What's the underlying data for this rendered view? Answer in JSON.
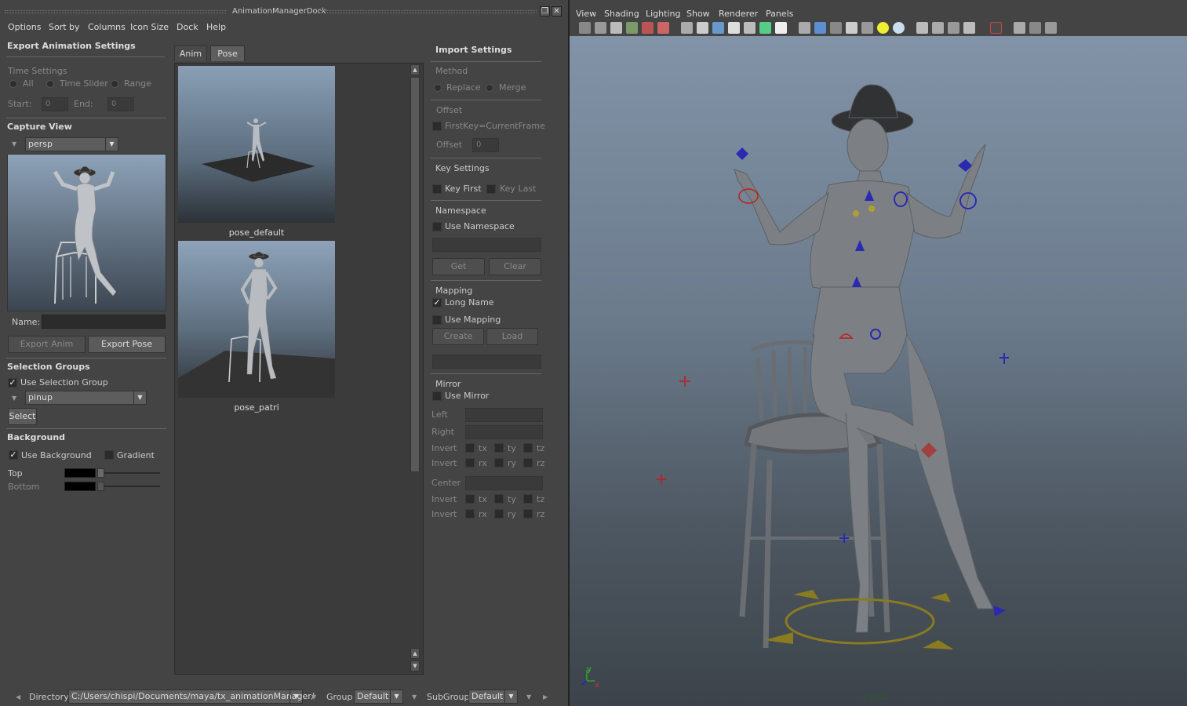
{
  "window": {
    "title": "AnimationManagerDock"
  },
  "menu": [
    "Options",
    "Sort by",
    "Columns",
    "Icon Size",
    "Dock",
    "Help"
  ],
  "export": {
    "header": "Export Animation Settings",
    "time_settings_label": "Time Settings",
    "radio_all": "All",
    "radio_time_slider": "Time Slider",
    "radio_range": "Range",
    "start_label": "Start:",
    "start_value": "0",
    "end_label": "End:",
    "end_value": "0"
  },
  "capture": {
    "header": "Capture View",
    "camera": "persp",
    "name_label": "Name:",
    "name_value": "",
    "export_anim_button": "Export Anim",
    "export_pose_button": "Export Pose"
  },
  "selection": {
    "header": "Selection Groups",
    "use_group_label": "Use Selection Group",
    "use_group_checked": true,
    "group": "pinup",
    "select_button": "Select"
  },
  "background": {
    "header": "Background",
    "use_bg_label": "Use Background",
    "use_bg_checked": true,
    "gradient_label": "Gradient",
    "gradient_checked": false,
    "top_label": "Top",
    "bottom_label": "Bottom",
    "top_color": "#000000",
    "bottom_color": "#000000"
  },
  "tabs": [
    {
      "label": "Anim",
      "active": false
    },
    {
      "label": "Pose",
      "active": true
    }
  ],
  "poses": [
    {
      "name": "pose_default"
    },
    {
      "name": "pose_patri"
    }
  ],
  "import": {
    "header": "Import Settings",
    "method_label": "Method",
    "replace_label": "Replace",
    "merge_label": "Merge",
    "offset_label": "Offset",
    "firstkey_label": "FirstKey=CurrentFrame",
    "offset_field_label": "Offset",
    "offset_value": "0",
    "key_settings_label": "Key Settings",
    "key_first_label": "Key First",
    "key_last_label": "Key Last",
    "namespace_label": "Namespace",
    "use_namespace_label": "Use Namespace",
    "get_button": "Get",
    "clear_button": "Clear",
    "mapping_label": "Mapping",
    "long_name_label": "Long Name",
    "long_name_checked": true,
    "use_mapping_label": "Use Mapping",
    "create_button": "Create",
    "load_button": "Load",
    "mirror_label": "Mirror",
    "use_mirror_label": "Use Mirror",
    "left_label": "Left",
    "right_label": "Right",
    "invert_label": "Invert",
    "center_label": "Center",
    "tx": "tx",
    "ty": "ty",
    "tz": "tz",
    "rx": "rx",
    "ry": "ry",
    "rz": "rz"
  },
  "bottom": {
    "directory_label": "Directory",
    "directory_value": "C:/Users/chispi/Documents/maya/tx_animationManager/",
    "group_label": "Group",
    "group_value": "Default",
    "subgroup_label": "SubGroup",
    "subgroup_value": "Default"
  },
  "viewport": {
    "menu": [
      "View",
      "Shading",
      "Lighting",
      "Show",
      "Renderer",
      "Panels"
    ],
    "camera_label": "persp",
    "axis_x": "x",
    "axis_y": "y"
  }
}
